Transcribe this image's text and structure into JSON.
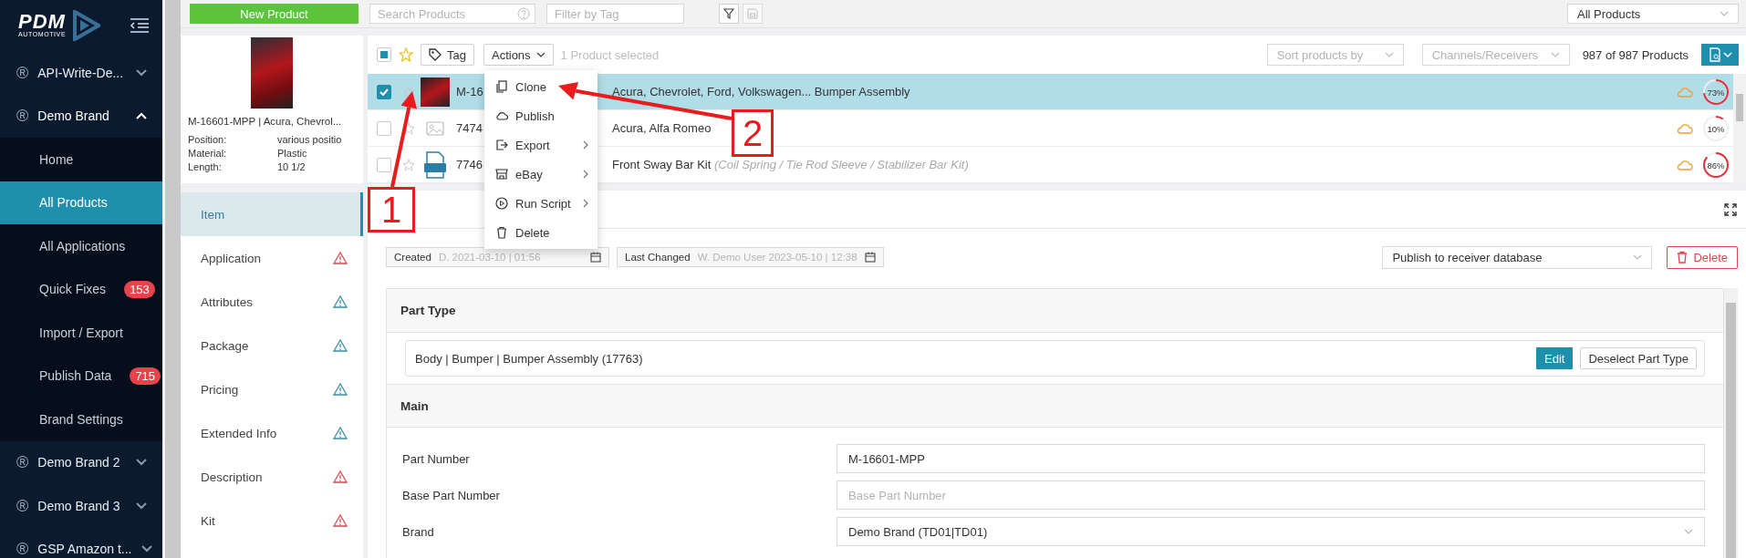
{
  "sidebar": {
    "logo": {
      "text": "PDM",
      "subtext": "AUTOMOTIVE"
    },
    "brands": [
      {
        "icon": "®",
        "label": "API-Write-De...",
        "expanded": false
      },
      {
        "icon": "®",
        "label": "Demo Brand",
        "expanded": true,
        "children": [
          {
            "label": "Home",
            "selected": false
          },
          {
            "label": "All Products",
            "selected": true
          },
          {
            "label": "All Applications",
            "selected": false
          },
          {
            "label": "Quick Fixes",
            "badge": "153",
            "selected": false
          },
          {
            "label": "Import / Export",
            "selected": false
          },
          {
            "label": "Publish Data",
            "badge": "715",
            "selected": false
          },
          {
            "label": "Brand Settings",
            "selected": false
          }
        ]
      },
      {
        "icon": "®",
        "label": "Demo Brand 2",
        "expanded": false
      },
      {
        "icon": "®",
        "label": "Demo Brand 3",
        "expanded": false
      },
      {
        "icon": "®",
        "label": "GSP Amazon t...",
        "expanded": false
      }
    ]
  },
  "topbar": {
    "new_button": "New Product",
    "search": {
      "placeholder": "Search Products"
    },
    "tag_filter": {
      "placeholder": "Filter by Tag"
    },
    "view_select": "All Products"
  },
  "product_card": {
    "title": "M-16601-MPP | Acura, Chevrol...",
    "attributes": [
      {
        "label": "Position:",
        "value": "various positio"
      },
      {
        "label": "Material:",
        "value": "Plastic"
      },
      {
        "label": "Length:",
        "value": "10 1/2"
      }
    ]
  },
  "item_nav": [
    {
      "label": "Item",
      "selected": true
    },
    {
      "label": "Application",
      "selected": false,
      "color": "#d9474f"
    },
    {
      "label": "Attributes",
      "selected": false,
      "color": "#3b8db0"
    },
    {
      "label": "Package",
      "selected": false,
      "color": "#3b8db0"
    },
    {
      "label": "Pricing",
      "selected": false,
      "color": "#3b8db0"
    },
    {
      "label": "Extended Info",
      "selected": false,
      "color": "#3b8db0"
    },
    {
      "label": "Description",
      "selected": false,
      "color": "#d9474f"
    },
    {
      "label": "Kit",
      "selected": false,
      "color": "#d9474f"
    }
  ],
  "product_list": {
    "select_all": {
      "checked": true,
      "partial": true
    },
    "tag_button": "Tag",
    "actions_button": "Actions",
    "selection_text": "1 Product selected",
    "sort": {
      "placeholder": "Sort products by"
    },
    "channels": {
      "placeholder": "Channels/Receivers"
    },
    "count": "987 of 987 Products",
    "rows": [
      {
        "checked": true,
        "selected": true,
        "kind": "photo",
        "part_number": "M-16",
        "description": "Acura, Chevrolet, Ford, Volkswagen... Bumper Assembly",
        "completeness": "73%"
      },
      {
        "checked": false,
        "selected": false,
        "kind": "placeholder",
        "part_number": "7474",
        "description": "Acura, Alfa Romeo",
        "completeness": "10%"
      },
      {
        "checked": false,
        "selected": false,
        "kind": "file",
        "part_number": "7746",
        "description": "Front Sway Bar Kit",
        "subtitle": "(Coil Spring / Tie Rod Sleeve / Stabilizer Bar Kit)",
        "completeness": "86%"
      }
    ]
  },
  "actions_menu": [
    {
      "label": "Clone",
      "kind": "copy",
      "submenu": false
    },
    {
      "label": "Publish",
      "kind": "cloud",
      "submenu": false
    },
    {
      "label": "Export",
      "kind": "export",
      "submenu": true
    },
    {
      "label": "eBay",
      "kind": "store",
      "submenu": true
    },
    {
      "label": "Run Script",
      "kind": "play",
      "submenu": true
    },
    {
      "label": "Delete",
      "kind": "trash",
      "submenu": false
    }
  ],
  "detail": {
    "created": {
      "label": "Created",
      "value": "D. 2021-03-10 | 01:56"
    },
    "last_changed": {
      "label": "Last Changed",
      "value": "W. Demo User 2023-05-10 | 12:38"
    },
    "publish_select": "Publish to receiver database",
    "delete_button": "Delete",
    "part_type": {
      "title": "Part Type",
      "value": "Body | Bumper | Bumper Assembly (17763)",
      "edit_button": "Edit",
      "deselect_button": "Deselect Part Type"
    },
    "main": {
      "title": "Main",
      "fields": [
        {
          "label": "Part Number",
          "kind": "text",
          "value": "M-16601-MPP"
        },
        {
          "label": "Base Part Number",
          "kind": "text",
          "placeholder": "Base Part Number"
        },
        {
          "label": "Brand",
          "kind": "select",
          "value": "Demo Brand (TD01|TD01)"
        }
      ]
    }
  },
  "annotations": [
    {
      "label": "1"
    },
    {
      "label": "2"
    }
  ]
}
